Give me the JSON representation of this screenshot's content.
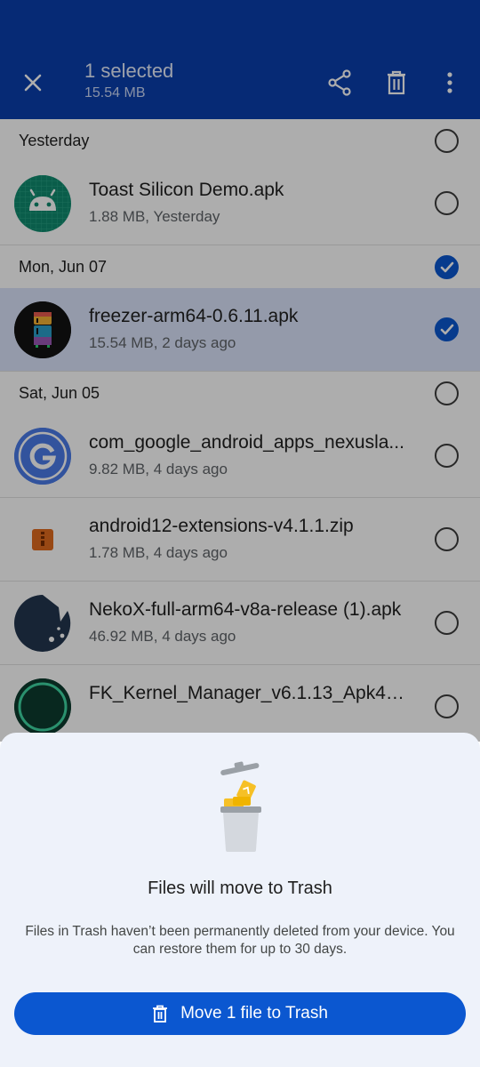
{
  "appbar": {
    "title": "1 selected",
    "subtitle": "15.54 MB",
    "icons": [
      "close-icon",
      "share-icon",
      "trash-icon",
      "more-vert-icon"
    ]
  },
  "list": {
    "sections": [
      {
        "label": "Yesterday",
        "checked": false,
        "items": [
          {
            "name": "Toast Silicon Demo.apk",
            "meta": "1.88 MB, Yesterday",
            "icon": "android-icon",
            "checked": false
          }
        ]
      },
      {
        "label": "Mon, Jun 07",
        "checked": true,
        "items": [
          {
            "name": "freezer-arm64-0.6.11.apk",
            "meta": "15.54 MB, 2 days ago",
            "icon": "freezer-app-icon",
            "checked": true
          }
        ]
      },
      {
        "label": "Sat, Jun 05",
        "checked": false,
        "items": [
          {
            "name": "com_google_android_apps_nexusla...",
            "meta": "9.82 MB, 4 days ago",
            "icon": "google-icon",
            "checked": false
          },
          {
            "name": "android12-extensions-v4.1.1.zip",
            "meta": "1.78 MB, 4 days ago",
            "icon": "zip-icon",
            "checked": false
          },
          {
            "name": "NekoX-full-arm64-v8a-release (1).apk",
            "meta": "46.92 MB, 4 days ago",
            "icon": "nekox-icon",
            "checked": false
          },
          {
            "name": "FK_Kernel_Manager_v6.1.13_Apk4all...",
            "meta": "",
            "icon": "fk-kernel-icon",
            "checked": false
          }
        ]
      }
    ]
  },
  "sheet": {
    "title": "Files will move to Trash",
    "body": "Files in Trash haven’t been permanently deleted from your device. You can restore them for up to 30 days.",
    "button_label": "Move 1 file to Trash",
    "accent": "#0b57d0"
  },
  "colors": {
    "appbar": "#0a3fad",
    "selected_row": "#dbe4fb"
  }
}
